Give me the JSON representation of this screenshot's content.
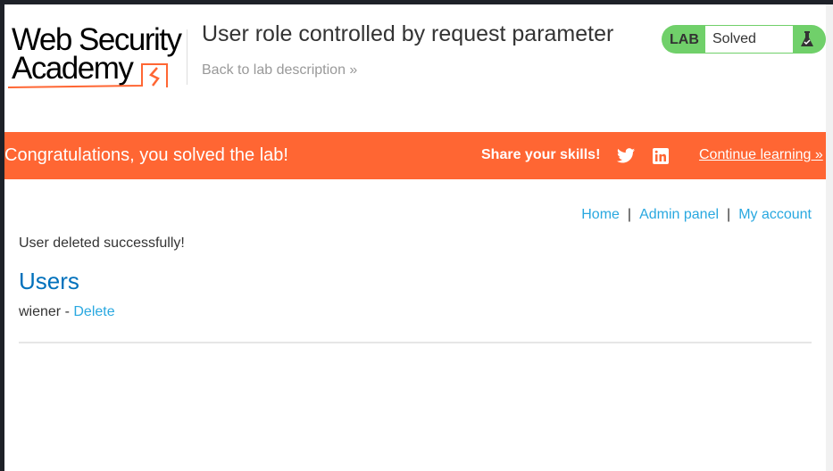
{
  "logo": {
    "line1": "Web Security",
    "line2": "Academy"
  },
  "header": {
    "title": "User role controlled by request parameter",
    "back_link": "Back to lab description »"
  },
  "status": {
    "label": "LAB",
    "value": "Solved",
    "icon": "flask-check-icon",
    "color": "#70d06a"
  },
  "banner": {
    "message": "Congratulations, you solved the lab!",
    "share": "Share your skills!",
    "continue": "Continue learning »",
    "color": "#ff6633"
  },
  "nav": {
    "home": "Home",
    "separator": "|",
    "admin": "Admin panel",
    "account": "My account"
  },
  "main": {
    "message": "User deleted successfully!",
    "heading": "Users",
    "users": [
      {
        "name": "wiener",
        "separator": " - ",
        "action": "Delete"
      }
    ]
  }
}
